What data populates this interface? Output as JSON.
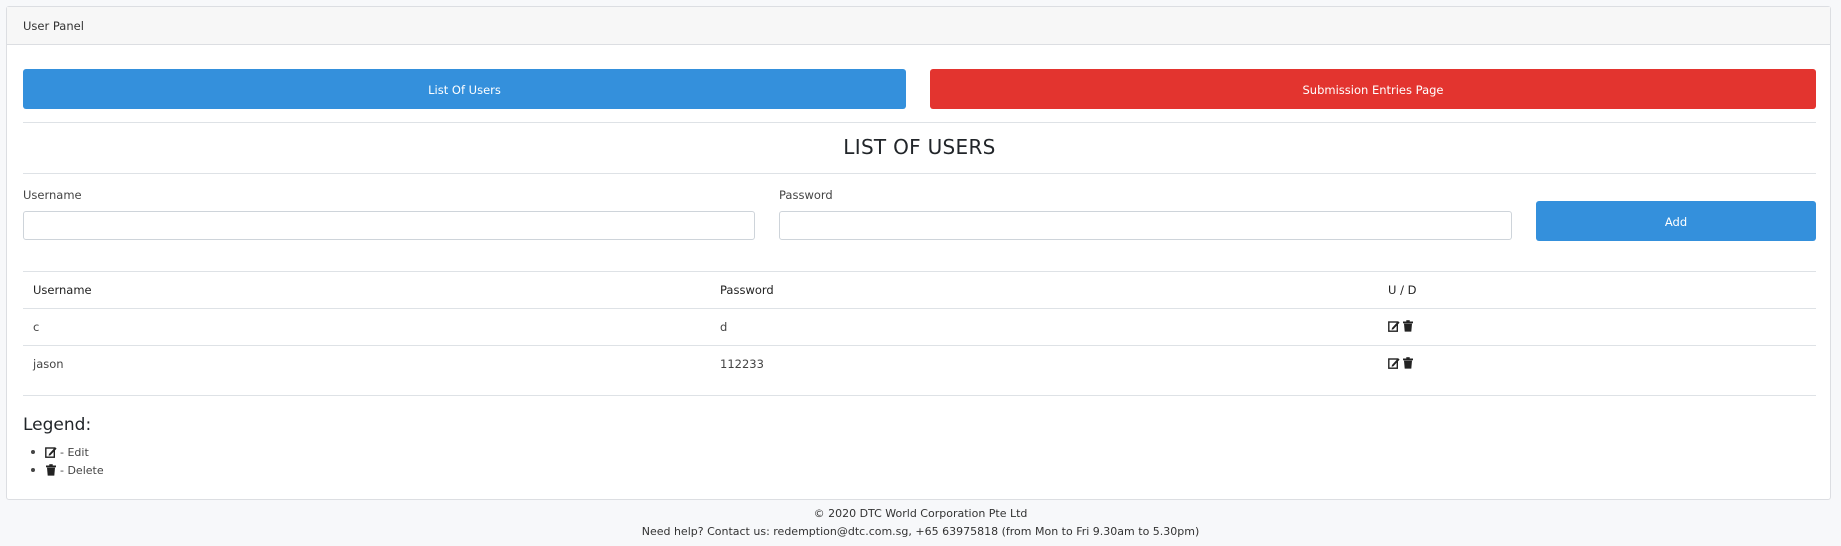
{
  "panel": {
    "header": "User Panel"
  },
  "nav": {
    "list_users": "List Of Users",
    "submission_entries": "Submission Entries Page"
  },
  "page": {
    "title": "LIST OF USERS"
  },
  "form": {
    "username_label": "Username",
    "password_label": "Password",
    "username_value": "",
    "password_value": "",
    "add_label": "Add"
  },
  "table": {
    "headers": [
      "Username",
      "Password",
      "U / D"
    ],
    "rows": [
      {
        "username": "c",
        "password": "d"
      },
      {
        "username": "jason",
        "password": "112233"
      }
    ]
  },
  "legend": {
    "title": "Legend:",
    "edit": "- Edit",
    "delete": "- Delete"
  },
  "footer": {
    "copyright": "© 2020 DTC World Corporation Pte Ltd",
    "help_prefix": "Need help? Contact us:",
    "email": "redemption@dtc.com.sg",
    "phone": ", +65 63975818 (from Mon to Fri 9.30am to 5.30pm)"
  },
  "colors": {
    "primary": "#3490dc",
    "danger": "#e3342f"
  },
  "icons": {
    "edit": "edit-icon",
    "delete": "trash-icon"
  }
}
